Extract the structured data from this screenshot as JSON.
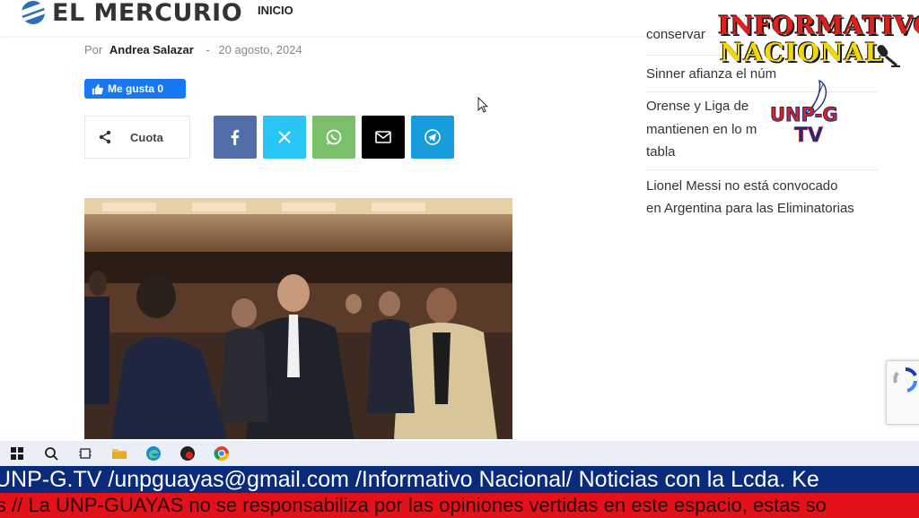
{
  "header": {
    "logo_text": "EL MERCURIO",
    "nav_inicio": "INICIO"
  },
  "byline": {
    "prefix": "Por",
    "author": "Andrea Salazar",
    "separator": "-",
    "date": "20 agosto, 2024"
  },
  "like": {
    "label": "Me gusta 0"
  },
  "share": {
    "label": "Cuota",
    "buttons": [
      "facebook-icon",
      "x-icon",
      "whatsapp-icon",
      "email-icon",
      "telegram-icon"
    ]
  },
  "sidebar": {
    "items": [
      {
        "text": "conservar"
      },
      {
        "text": "Sinner afianza el núm"
      },
      {
        "text": "Orense y Liga de "
      },
      {
        "text": "mantienen en lo m"
      },
      {
        "text": "tabla"
      },
      {
        "text": "Lionel Messi no está convocado"
      },
      {
        "text": "en Argentina para las Eliminatorias"
      }
    ]
  },
  "overlay": {
    "brand_line1": "INFORMATIVO",
    "brand_line2": "NACIONAL",
    "unp_text": "UNP-G",
    "tv_text": "TV"
  },
  "tickers": {
    "line1": "UNP-G.TV /unpguayas@gmail.com /Informativo Nacional/ Noticias con la Lcda. Ke",
    "line2": "s // La UNP-GUAYAS no se responsabiliza por las opiniones vertidas en este espacio, estas so"
  },
  "colors": {
    "facebook": "#516eab",
    "twitter": "#29c5f6",
    "whatsapp": "#7bbf6a",
    "email": "#000000",
    "telegram": "#179cde",
    "ticker_blue": "#0a2a7c",
    "ticker_red": "#e3121a"
  }
}
